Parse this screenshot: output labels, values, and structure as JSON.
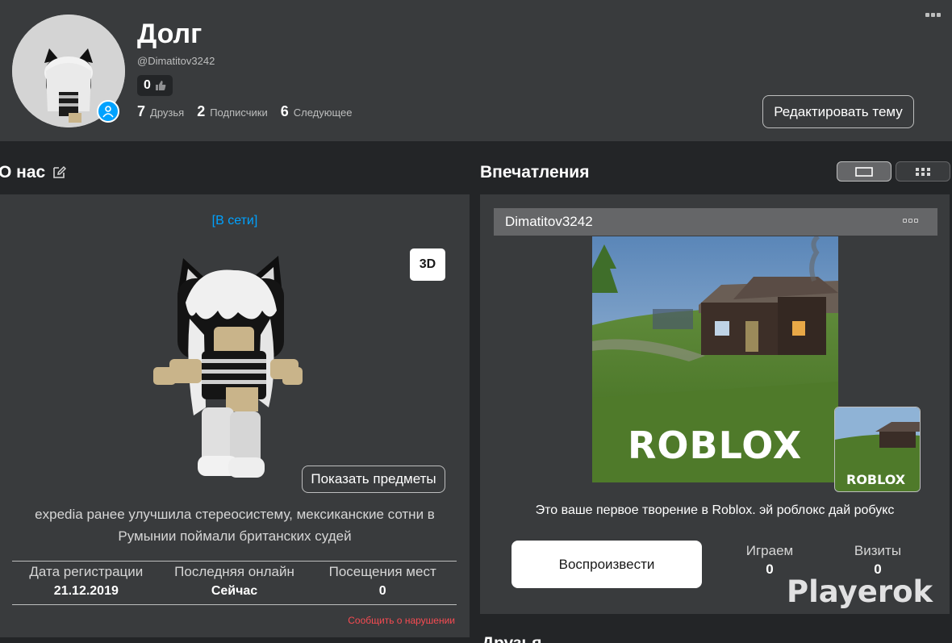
{
  "profile": {
    "display_name": "Долг",
    "username": "@Dimatitov3242",
    "likes": "0",
    "stats": [
      {
        "count": "7",
        "label": "Друзья"
      },
      {
        "count": "2",
        "label": "Подписчики"
      },
      {
        "count": "6",
        "label": "Следующее"
      }
    ],
    "edit_theme_label": "Редактировать тему"
  },
  "about": {
    "title": "О нас",
    "status": "[В сети]",
    "view_3d_label": "3D",
    "show_items_label": "Показать предметы",
    "description": "expedia ранее улучшила стереосистему, мексиканские сотни в Румынии поймали британских судей",
    "stats": [
      {
        "label": "Дата регистрации",
        "value": "21.12.2019"
      },
      {
        "label": "Последняя онлайн",
        "value": "Сейчас"
      },
      {
        "label": "Посещения мест",
        "value": "0"
      }
    ],
    "report_label": "Сообщить о нарушении"
  },
  "impressions": {
    "title": "Впечатления",
    "experience_name": "Dimatitov3242",
    "thumbnail_logo": "ROBLOX",
    "description": "Это ваше первое творение в Roblox. эй роблокс дай робукс",
    "play_label": "Воспроизвести",
    "playing_label": "Играем",
    "playing_value": "0",
    "visits_label": "Визиты",
    "visits_value": "0"
  },
  "friends_title": "Друзья",
  "watermark": "Playerok",
  "colors": {
    "accent": "#00a2ff",
    "report": "#f74b52",
    "panel": "#393b3d",
    "background": "#232527"
  }
}
